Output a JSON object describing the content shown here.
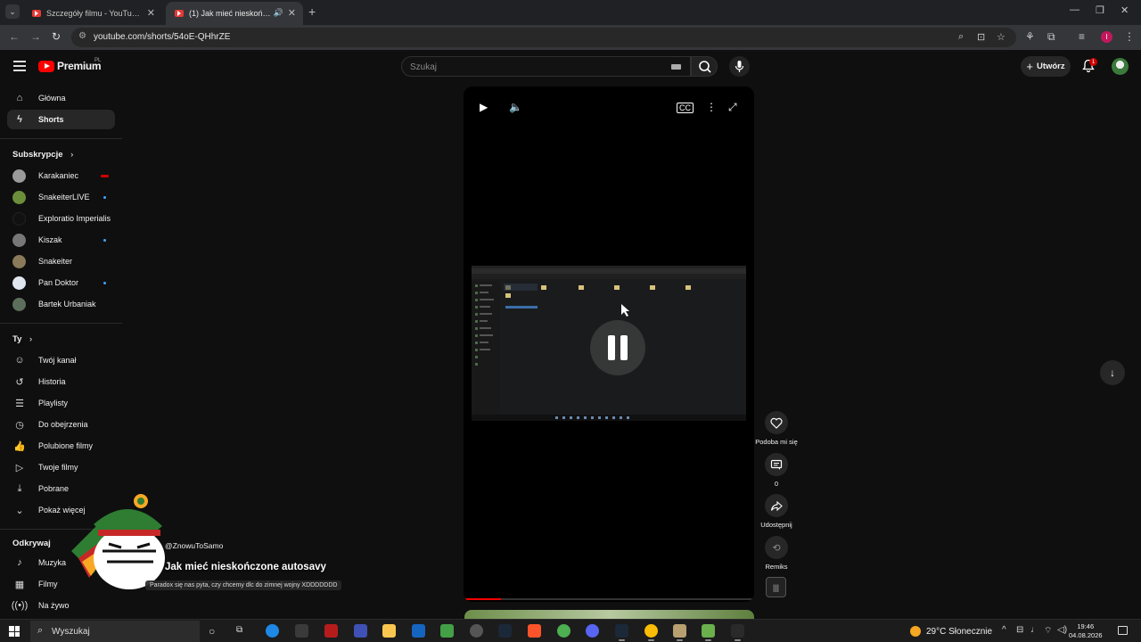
{
  "browser": {
    "tabs": [
      {
        "title": "Szczegóły filmu - YouTube Studio",
        "active": false
      },
      {
        "title": "(1) Jak mieć nieskończone autosavy",
        "active": true
      }
    ],
    "url": "youtube.com/shorts/54oE-QHhrZE",
    "profile_initial": "I"
  },
  "youtube": {
    "logo_text": "Premium",
    "country_code": "PL",
    "search_placeholder": "Szukaj",
    "create_label": "Utwórz",
    "notification_count": "1"
  },
  "sidebar": {
    "main": [
      {
        "label": "Główna",
        "icon": "home-icon"
      },
      {
        "label": "Shorts",
        "icon": "shorts-icon",
        "active": true
      }
    ],
    "subscriptions_header": "Subskrypcje",
    "subscriptions": [
      {
        "label": "Karakaniec",
        "status": "live",
        "color": "#9a9a9a"
      },
      {
        "label": "SnakeiterLIVE",
        "status": "new",
        "color": "#6b8e3a"
      },
      {
        "label": "Exploratio Imperialis",
        "status": "none",
        "color": "#111111"
      },
      {
        "label": "Kiszak",
        "status": "new",
        "color": "#777777"
      },
      {
        "label": "Snakeiter",
        "status": "none",
        "color": "#8a7a5a"
      },
      {
        "label": "Pan Doktor",
        "status": "new",
        "color": "#dfe6f0"
      },
      {
        "label": "Bartek Urbaniak",
        "status": "none",
        "color": "#5c6f5c"
      }
    ],
    "you_header": "Ty",
    "you": [
      {
        "label": "Twój kanał",
        "icon": "account-icon"
      },
      {
        "label": "Historia",
        "icon": "history-icon"
      },
      {
        "label": "Playlisty",
        "icon": "playlist-icon"
      },
      {
        "label": "Do obejrzenia",
        "icon": "watch-later-icon"
      },
      {
        "label": "Polubione filmy",
        "icon": "like-icon"
      },
      {
        "label": "Twoje filmy",
        "icon": "your-videos-icon"
      },
      {
        "label": "Pobrane",
        "icon": "download-icon"
      },
      {
        "label": "Pokaż więcej",
        "icon": "chevron-down-icon"
      }
    ],
    "explore_header": "Odkrywaj",
    "explore": [
      {
        "label": "Muzyka",
        "icon": "music-icon"
      },
      {
        "label": "Filmy",
        "icon": "movies-icon"
      },
      {
        "label": "Na żywo",
        "icon": "live-icon"
      }
    ]
  },
  "short": {
    "channel": "@ZnowuToSamo",
    "title": "Jak mieć nieskończone autosavy",
    "description": "Paradox się nas pyta, czy chcemy dlc do zimnej wojny XDDDDDDD",
    "progress_fraction": 0.13,
    "actions": {
      "like_label": "Podoba mi się",
      "comments_count": "0",
      "share_label": "Udostępnij",
      "remix_label": "Remiks"
    }
  },
  "taskbar": {
    "search_label": "Wyszukaj",
    "weather": "29°C  Słonecznie",
    "time": "19:46",
    "date": "04.08.2026"
  },
  "colors": {
    "yt_red": "#ff0000",
    "background": "#0f0f0f",
    "accent_blue": "#3ea6ff"
  }
}
